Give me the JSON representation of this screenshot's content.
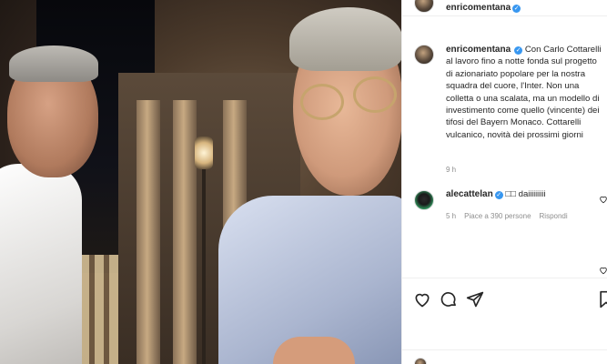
{
  "post": {
    "author": "enricomentana",
    "caption": "Con Carlo Cottarelli al lavoro fino a notte fonda sul progetto di azionariato popolare per la nostra squadra del cuore, l'Inter. Non una colletta o una scalata, ma un modello di investimento come quello (vincente) dei tifosi del Bayern Monaco. Cottarelli vulcanico, novità dei prossimi giorni",
    "time": "9 h"
  },
  "comment": {
    "author": "alecattelan",
    "text": "□□ daiiiiiiiii",
    "time": "5 h",
    "likes": "Piace a 390 persone",
    "reply": "Rispondi"
  },
  "icons": {
    "verified": "verified-badge",
    "like": "heart-icon",
    "comment": "comment-icon",
    "share": "paper-plane-icon",
    "save": "bookmark-icon"
  },
  "colors": {
    "verified": "#3897f0",
    "muted": "#8e8e8e",
    "divider": "#efefef"
  }
}
